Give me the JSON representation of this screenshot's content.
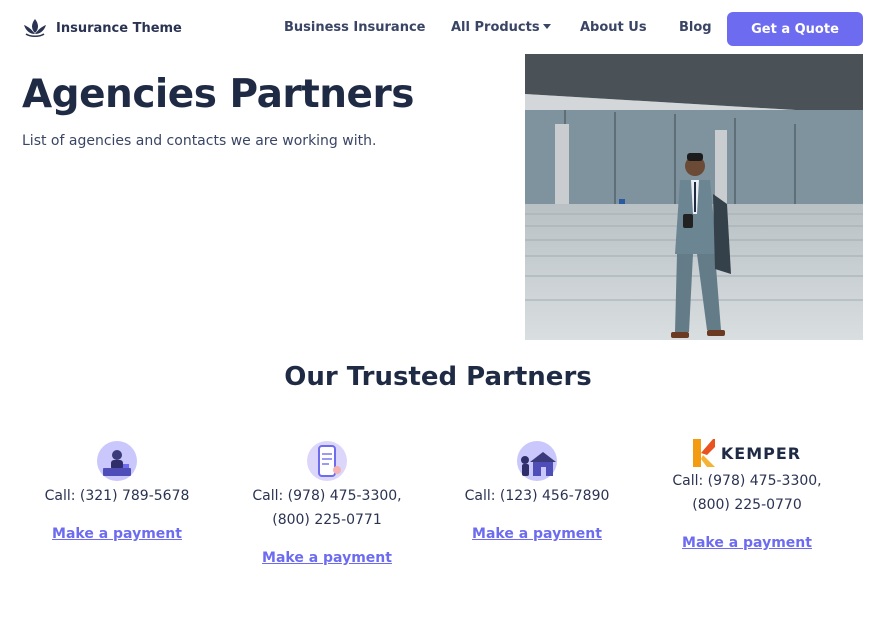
{
  "brand": {
    "name": "Insurance Theme",
    "logo_icon": "lotus-logo-icon"
  },
  "nav": {
    "business_insurance": "Business Insurance",
    "all_products": "All Products",
    "about_us": "About Us",
    "blog": "Blog",
    "cta": "Get a Quote"
  },
  "hero": {
    "title": "Agencies Partners",
    "subtitle": "List of agencies and contacts we are working with."
  },
  "partners_section": {
    "title": "Our Trusted Partners",
    "partners": [
      {
        "icon": "agent-desk-icon",
        "phone_line1": "Call: (321) 789-5678",
        "phone_line2": "",
        "link": "Make a payment"
      },
      {
        "icon": "document-phone-icon",
        "phone_line1": "Call: (978) 475-3300,",
        "phone_line2": "(800) 225-0771",
        "link": "Make a payment"
      },
      {
        "icon": "house-insurance-icon",
        "phone_line1": "Call: (123) 456-7890",
        "phone_line2": "",
        "link": "Make a payment"
      },
      {
        "logo_text": "KEMPER",
        "phone_line1": "Call: (978) 475-3300,",
        "phone_line2": "(800) 225-0770",
        "link": "Make a payment"
      }
    ]
  },
  "colors": {
    "accent": "#6d6cf0",
    "text_dark": "#1f2a44"
  }
}
